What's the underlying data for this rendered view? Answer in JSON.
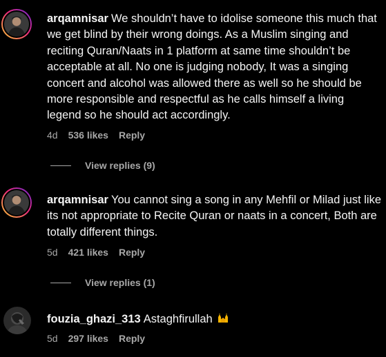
{
  "comments": [
    {
      "username": "arqamnisar",
      "text": "We shouldn’t have to idolise someone this much that we get blind by their wrong doings. As a Muslim singing and reciting Quran/Naats in 1 platform at same time shouldn’t be acceptable at all. No one is judging nobody, It was a singing concert and alcohol was allowed there as well so he should be more responsible and respectful as he calls himself a living legend so he should act accordingly.",
      "time": "4d",
      "likes": "536 likes",
      "reply": "Reply",
      "view_replies": "View replies (9)"
    },
    {
      "username": "arqamnisar",
      "text": "You cannot sing a song in any Mehfil or Milad just like its not appropriate to Recite Quran or naats in a concert, Both are totally different things.",
      "time": "5d",
      "likes": "421 likes",
      "reply": "Reply",
      "view_replies": "View replies (1)"
    },
    {
      "username": "fouzia_ghazi_313",
      "text": "Astaghfirullah",
      "emoji": "raising-hands-icon",
      "time": "5d",
      "likes": "297 likes",
      "reply": "Reply"
    }
  ],
  "colors": {
    "background": "#000000",
    "text": "#f5f5f5",
    "secondary": "#a8a8a8",
    "story_ring": [
      "#f9ce34",
      "#ee2a7b",
      "#6228d7"
    ]
  }
}
